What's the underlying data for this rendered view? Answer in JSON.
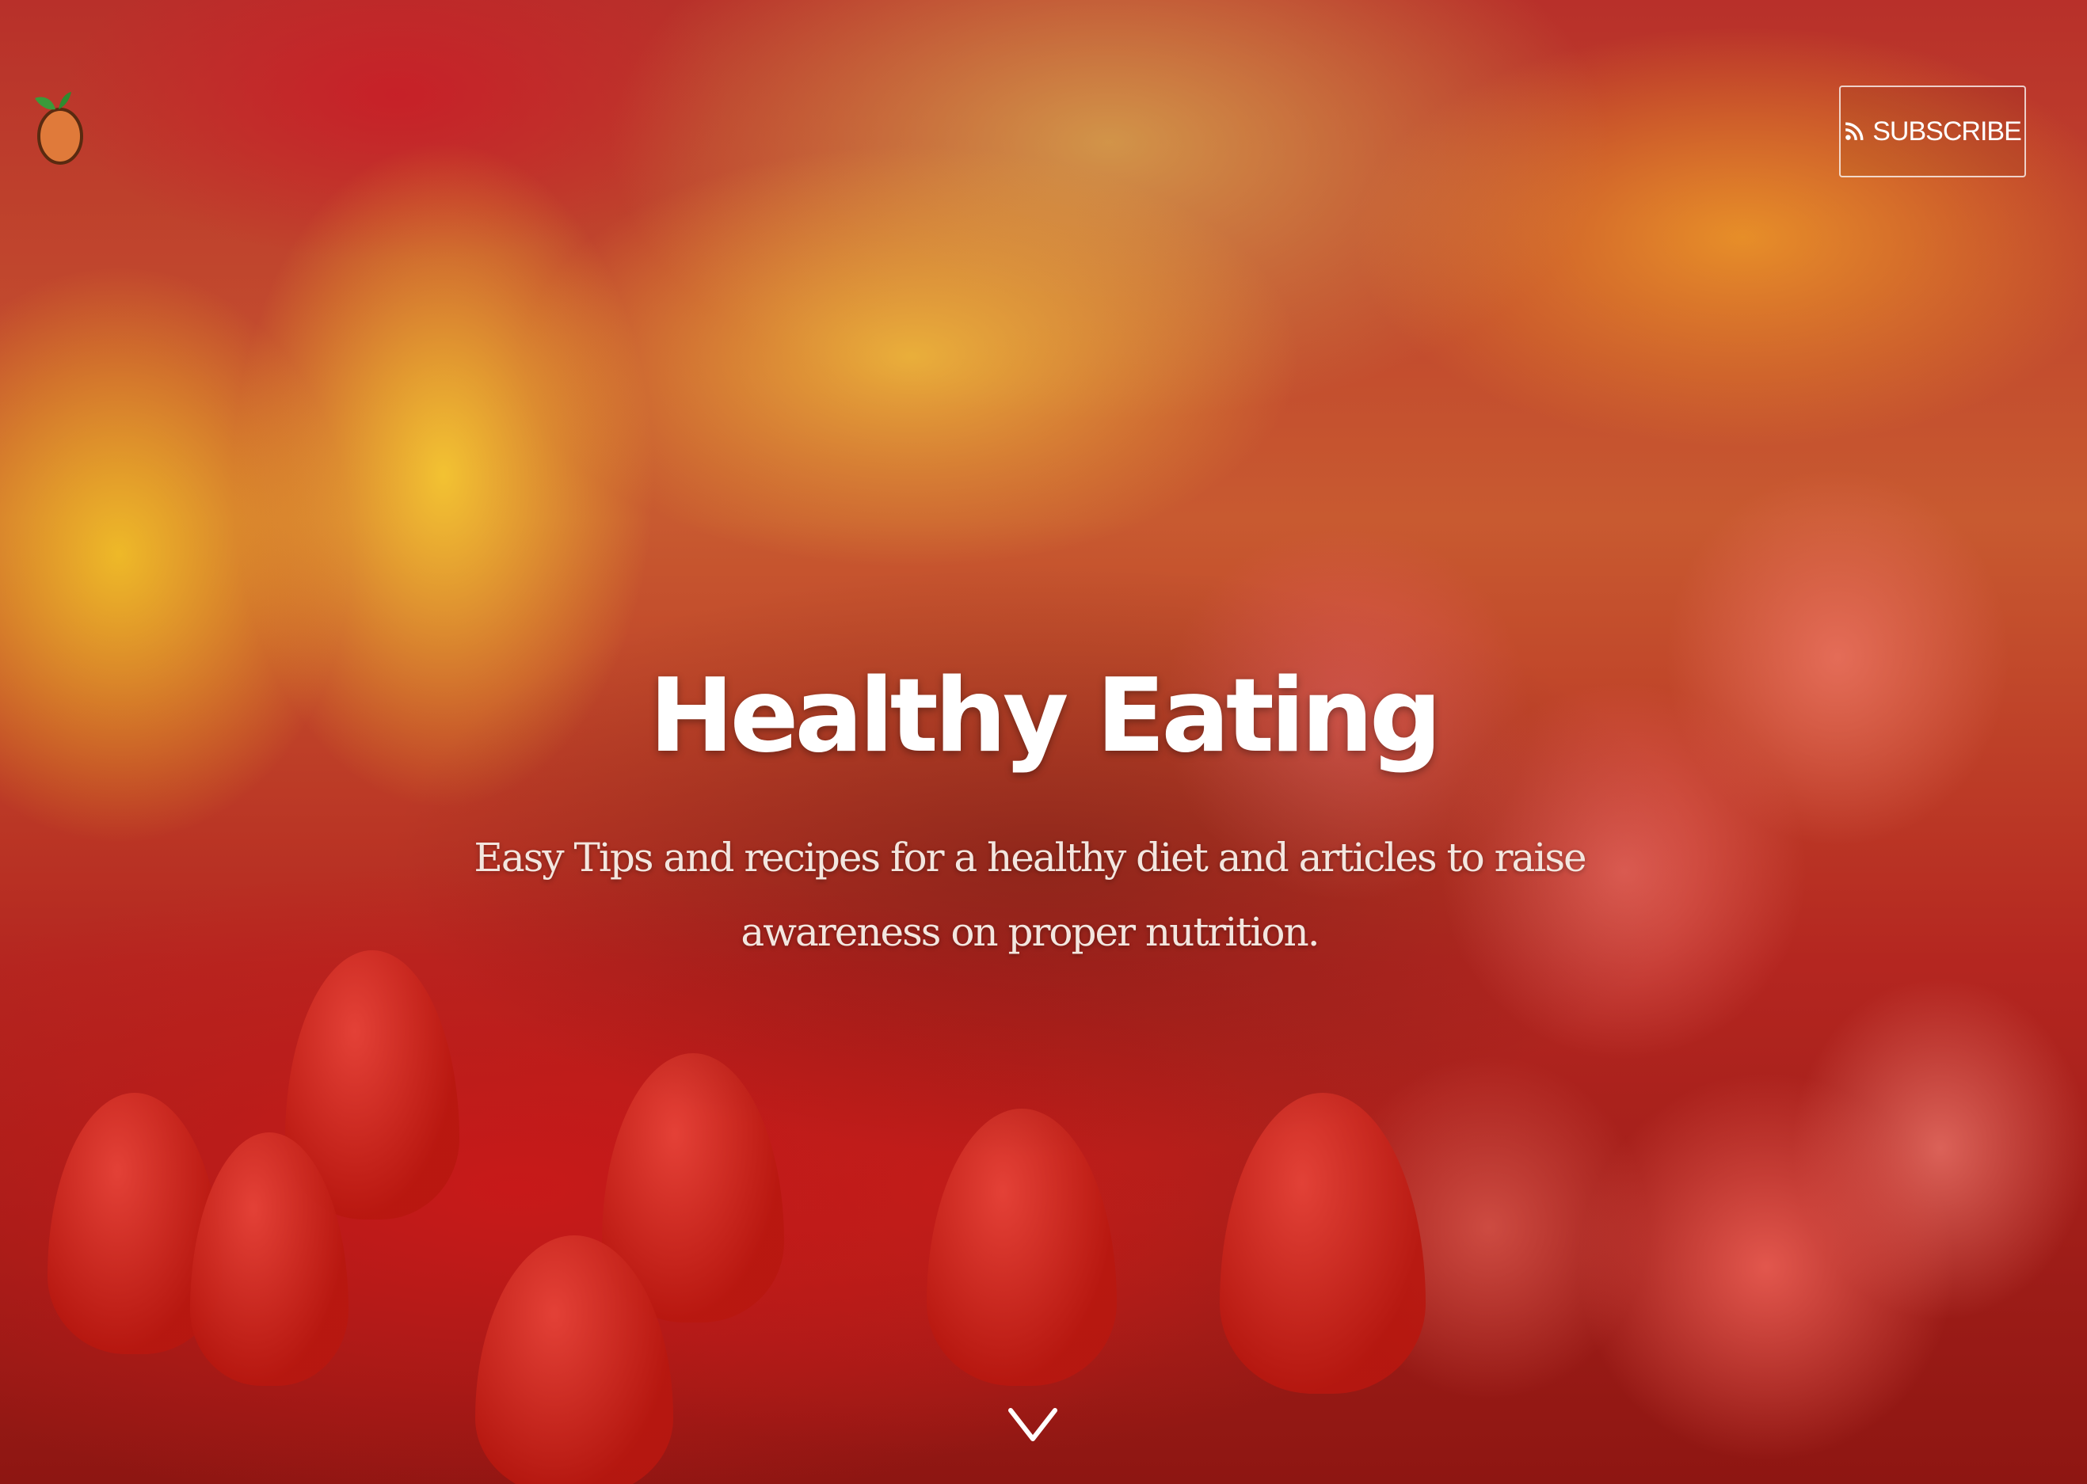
{
  "header": {
    "logo_icon": "fruit-logo-icon",
    "subscribe_label": "SUBSCRIBE",
    "subscribe_icon": "rss-icon"
  },
  "hero": {
    "title": "Healthy Eating",
    "subtitle": "Easy Tips and recipes for a healthy diet and articles to raise awareness on proper nutrition.",
    "scroll_icon": "chevron-down-icon"
  },
  "colors": {
    "text": "#ffffff",
    "subtitle_text": "#f3e6df",
    "logo_fruit": "#e07a3a",
    "logo_leaf": "#3a9a3a"
  }
}
